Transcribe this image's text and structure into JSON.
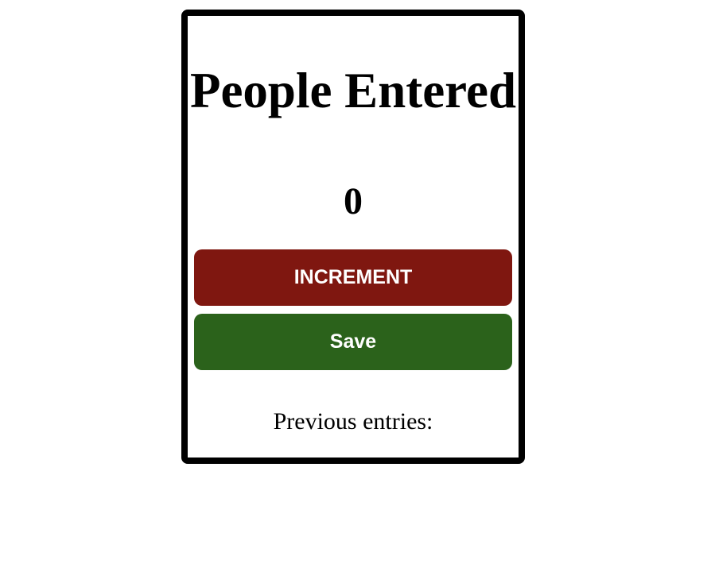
{
  "counter": {
    "title": "People Entered",
    "count": "0",
    "increment_label": "INCREMENT",
    "save_label": "Save",
    "previous_entries_label": "Previous entries:"
  },
  "colors": {
    "increment": "#7f1710",
    "save": "#2b621b",
    "border": "#000000"
  }
}
